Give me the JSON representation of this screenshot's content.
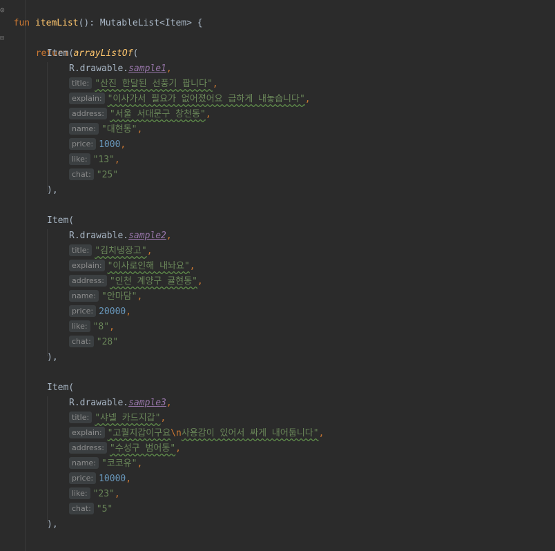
{
  "signature": {
    "keyword": "fun",
    "name": "itemList",
    "parens": "():",
    "return_type": "MutableList<Item>",
    "brace": "{"
  },
  "return_stmt": {
    "keyword": "return",
    "call": "arrayListOf",
    "paren": "("
  },
  "labels": {
    "ctor": "Item(",
    "close": "),",
    "resource_prefix": "R.drawable.",
    "comma": ",",
    "escape": "\\n"
  },
  "hints": {
    "title": "title:",
    "explain": "explain:",
    "address": "address:",
    "name": "name:",
    "price": "price:",
    "like": "like:",
    "chat": "chat:"
  },
  "items": [
    {
      "image": "sample1",
      "title": "\"산진 한달된 선풍기 팝니다\"",
      "explain": "\"이사가서 필요가 없어졌어요 급하게 내놓습니다\"",
      "address": "\"서울 서대문구 창천동\"",
      "name": "\"대현동\"",
      "price": "1000",
      "like": "\"13\"",
      "chat": "\"25\""
    },
    {
      "image": "sample2",
      "title": "\"김치냉장고\"",
      "explain": "\"이사로인해 내놔요\"",
      "address": "\"인천 계양구 귤현동\"",
      "name": "\"안마담\"",
      "price": "20000",
      "like": "\"8\"",
      "chat": "\"28\""
    },
    {
      "image": "sample3",
      "title": "\"샤넬 카드지갑\"",
      "explain_before": "\"고퀄지갑이구요",
      "explain_after": "사용감이 있어서 싸게 내어둡니다\"",
      "address": "\"수성구 범어동\"",
      "name": "\"코코유\"",
      "price": "10000",
      "like": "\"23\"",
      "chat": "\"5\""
    }
  ]
}
